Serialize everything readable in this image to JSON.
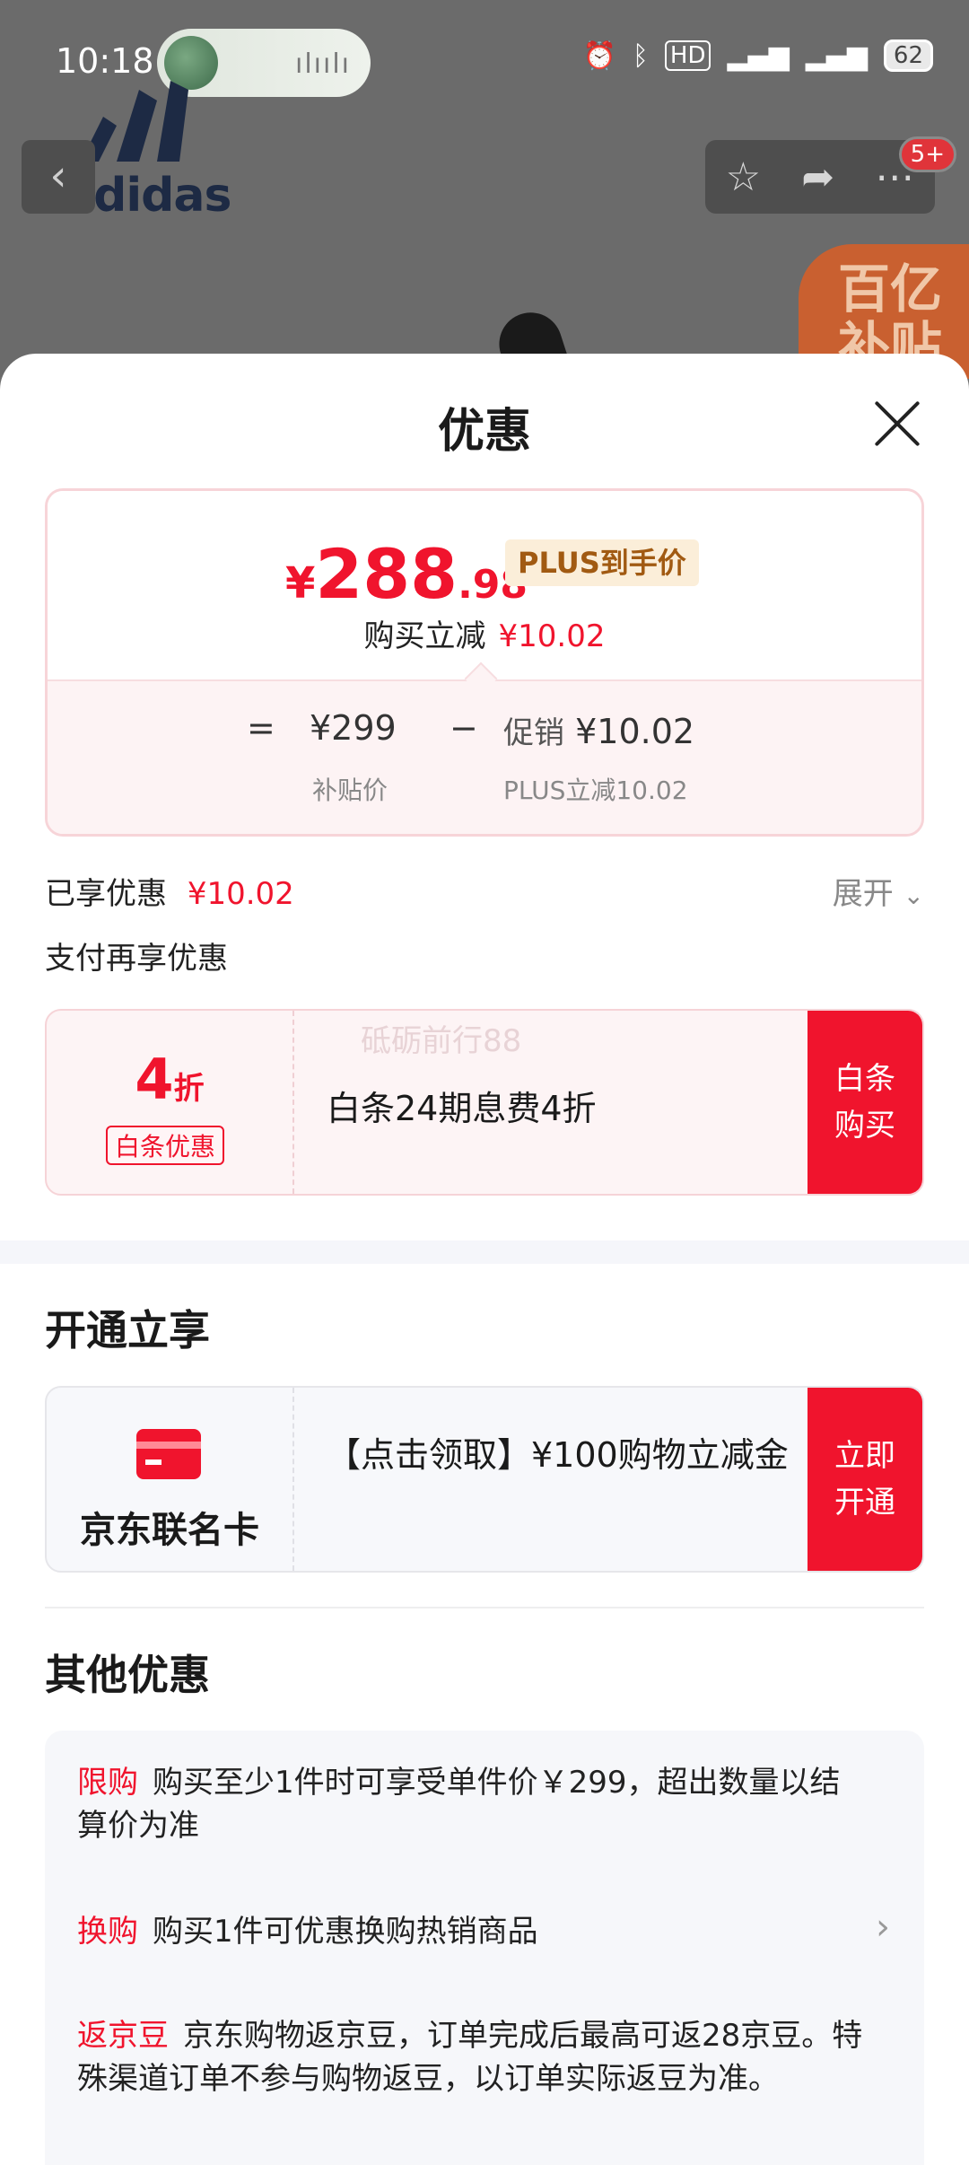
{
  "status_bar": {
    "time": "10:18",
    "voice_wave": "ılıılı",
    "icons": [
      "alarm-icon",
      "bluetooth-icon",
      "hd-icon",
      "5g-signal-icon",
      "5g-signal-icon"
    ],
    "battery": "62"
  },
  "background": {
    "brand_text": "adidas",
    "badge": "5+",
    "promo_corner": "百亿补贴"
  },
  "sheet": {
    "title": "优惠",
    "price": {
      "currency": "¥",
      "integer": "288",
      "decimal": ".98",
      "tag": "PLUS到手价",
      "reduction_label": "购买立减",
      "reduction_value": "¥10.02",
      "calc": {
        "equals": "=",
        "base_price": "¥299",
        "base_label": "补贴价",
        "minus": "−",
        "promo_label": "促销",
        "promo_value": "¥10.02",
        "promo_sub": "PLUS立减10.02"
      }
    },
    "enjoyed": {
      "label": "已享优惠",
      "value": "¥10.02",
      "expand": "展开"
    },
    "pay_more_label": "支付再享优惠",
    "baitiao": {
      "discount_num": "4",
      "discount_unit": "折",
      "tag": "白条优惠",
      "text": "白条24期息费4折",
      "watermark": "砥砺前行88",
      "button": "白条购买"
    },
    "open_section": {
      "title": "开通立享",
      "card_name": "京东联名卡",
      "text": "【点击领取】¥100购物立减金",
      "button": "立即开通"
    },
    "other_section": {
      "title": "其他优惠",
      "items": [
        {
          "tag": "限购",
          "text": "购买至少1件时可享受单件价￥299，超出数量以结算价为准"
        },
        {
          "tag": "换购",
          "text": "购买1件可优惠换购热销商品"
        },
        {
          "tag": "返京豆",
          "text": "京东购物返京豆，订单完成后最高可返28京豆。特殊渠道订单不参与购物返豆，以订单实际返豆为准。"
        }
      ]
    }
  }
}
